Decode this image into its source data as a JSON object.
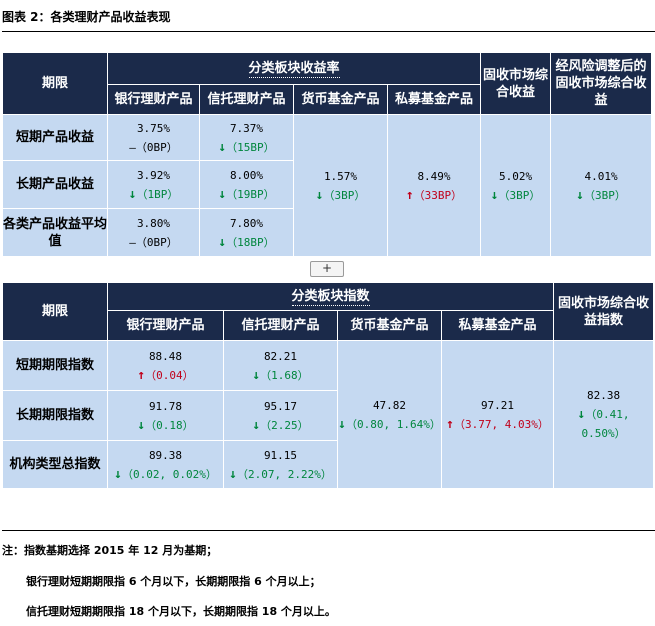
{
  "figure_title": "图表 2：各类理财产品收益表现",
  "table1": {
    "header": {
      "period": "期限",
      "group": "分类板块收益率",
      "cols": [
        "银行理财产品",
        "信托理财产品",
        "货币基金产品",
        "私募基金产品"
      ],
      "fixed": "固收市场综合收益",
      "risk_adj": "经风险调整后的固收市场综合收益"
    },
    "rows": [
      {
        "label": "短期产品收益",
        "bank": {
          "value": "3.75%",
          "arrow": "–",
          "change": "（0BP）"
        },
        "trust": {
          "value": "7.37%",
          "arrow": "↓",
          "change": "（15BP）"
        }
      },
      {
        "label": "长期产品收益",
        "bank": {
          "value": "3.92%",
          "arrow": "↓",
          "change": "（1BP）"
        },
        "trust": {
          "value": "8.00%",
          "arrow": "↓",
          "change": "（19BP）"
        }
      },
      {
        "label": "各类产品收益平均值",
        "bank": {
          "value": "3.80%",
          "arrow": "–",
          "change": "（0BP）"
        },
        "trust": {
          "value": "7.80%",
          "arrow": "↓",
          "change": "（18BP）"
        }
      }
    ],
    "money": {
      "value": "1.57%",
      "arrow": "↓",
      "change": "（3BP）"
    },
    "private": {
      "value": "8.49%",
      "arrow": "↑",
      "change": "（33BP）"
    },
    "fixed": {
      "value": "5.02%",
      "arrow": "↓",
      "change": "（3BP）"
    },
    "risk_adj": {
      "value": "4.01%",
      "arrow": "↓",
      "change": "（3BP）"
    }
  },
  "expand_button": "+",
  "table2": {
    "header": {
      "period": "期限",
      "group": "分类板块指数",
      "cols": [
        "银行理财产品",
        "信托理财产品",
        "货币基金产品",
        "私募基金产品"
      ],
      "fixed": "固收市场综合收益指数"
    },
    "rows": [
      {
        "label": "短期期限指数",
        "bank": {
          "value": "88.48",
          "arrow": "↑",
          "change": "（0.04）"
        },
        "trust": {
          "value": "82.21",
          "arrow": "↓",
          "change": "（1.68）"
        }
      },
      {
        "label": "长期期限指数",
        "bank": {
          "value": "91.78",
          "arrow": "↓",
          "change": "（0.18）"
        },
        "trust": {
          "value": "95.17",
          "arrow": "↓",
          "change": "（2.25）"
        }
      },
      {
        "label": "机构类型总指数",
        "bank": {
          "value": "89.38",
          "arrow": "↓",
          "change": "（0.02, 0.02%）"
        },
        "trust": {
          "value": "91.15",
          "arrow": "↓",
          "change": "（2.07, 2.22%）"
        }
      }
    ],
    "money": {
      "value": "47.82",
      "arrow": "↓",
      "change": "（0.80, 1.64%）"
    },
    "private": {
      "value": "97.21",
      "arrow": "↑",
      "change": "（3.77, 4.03%）"
    },
    "fixed": {
      "value": "82.38",
      "arrow": "↓",
      "change1": "（0.41,",
      "change2": "0.50%）"
    }
  },
  "notes": {
    "line1": "注：指数基期选择 2015 年 12 月为基期；",
    "line2": "银行理财短期期限指 6 个月以下，长期期限指 6 个月以上；",
    "line3": "信托理财短期期限指 18 个月以下，长期期限指 18 个月以上。"
  }
}
